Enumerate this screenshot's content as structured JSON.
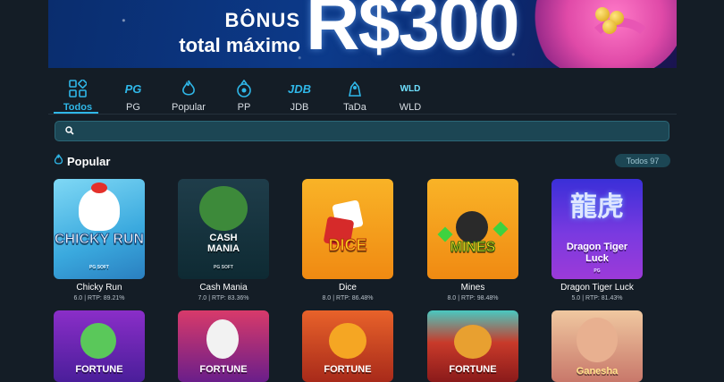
{
  "banner": {
    "line1": "BÔNUS",
    "line2": "total máximo",
    "amount": "R$300"
  },
  "tabs": [
    {
      "label": "Todos",
      "icon": "grid-icon",
      "active": true
    },
    {
      "label": "PG",
      "icon": "pg-logo-icon",
      "logo": "PG"
    },
    {
      "label": "Popular",
      "icon": "flame-icon"
    },
    {
      "label": "PP",
      "icon": "pp-logo-icon"
    },
    {
      "label": "JDB",
      "icon": "jdb-logo-icon",
      "logo": "JDB"
    },
    {
      "label": "TaDa",
      "icon": "tada-logo-icon"
    },
    {
      "label": "WLD",
      "icon": "wld-logo-icon",
      "logo": "WLD"
    }
  ],
  "search": {
    "placeholder": ""
  },
  "section": {
    "title": "Popular",
    "badge": "Todos 97"
  },
  "games_row1": [
    {
      "name": "Chicky Run",
      "rating": "6.0",
      "rtp": "RTP: 89.21%",
      "art": "CHICKY RUN",
      "art_sub": "PG SOFT"
    },
    {
      "name": "Cash Mania",
      "rating": "7.0",
      "rtp": "RTP: 83.36%",
      "art": "CASH MANIA",
      "art_sub": "PG SOFT"
    },
    {
      "name": "Dice",
      "rating": "8.0",
      "rtp": "RTP: 86.48%",
      "art": "DICE"
    },
    {
      "name": "Mines",
      "rating": "8.0",
      "rtp": "RTP: 98.48%",
      "art": "MINES"
    },
    {
      "name": "Dragon Tiger Luck",
      "rating": "5.0",
      "rtp": "RTP: 81.43%",
      "art": "Dragon Tiger Luck",
      "art_sub": "PG",
      "art_glyphs": "龍虎"
    }
  ],
  "games_row2": [
    {
      "art": "FORTUNE"
    },
    {
      "art": "FORTUNE"
    },
    {
      "art": "FORTUNE"
    },
    {
      "art": "FORTUNE"
    },
    {
      "art": "Ganesha"
    }
  ],
  "colors": {
    "background": "#141d26",
    "accent": "#2fb7e8",
    "search_bg": "#1c4654"
  }
}
